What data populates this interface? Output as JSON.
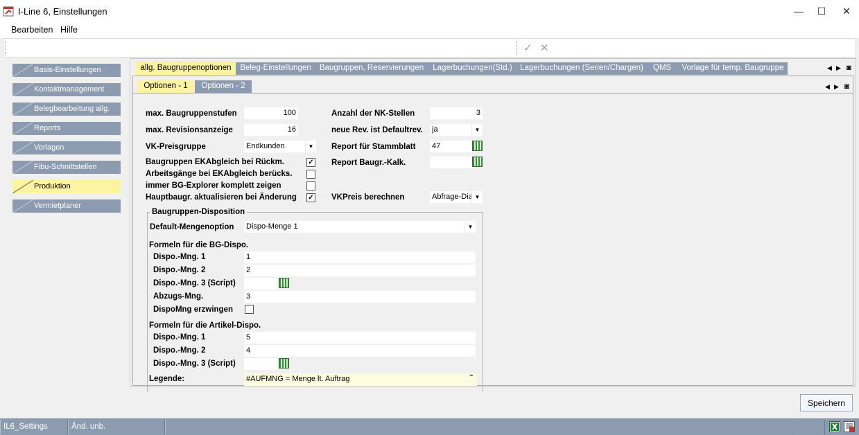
{
  "window": {
    "title": "I-Line 6, Einstellungen",
    "controls": {
      "minimize": "—",
      "maximize": "☐",
      "close": "✕"
    }
  },
  "menu": [
    "Bearbeiten",
    "Hilfe"
  ],
  "toolbar": {
    "confirm": "✓",
    "cancel": "✕"
  },
  "sidebar": {
    "items": [
      {
        "label": "Basis-Einstellungen"
      },
      {
        "label": "Kontaktmanagement"
      },
      {
        "label": "Belegbearbeitung allg."
      },
      {
        "label": "Reports"
      },
      {
        "label": "Vorlagen"
      },
      {
        "label": "Fibu-Schnittstellen"
      },
      {
        "label": "Produktion",
        "active": true
      },
      {
        "label": "Vermietplaner"
      }
    ]
  },
  "tabs": [
    {
      "label": "allg. Baugruppenoptionen",
      "active": true
    },
    {
      "label": "Beleg-Einstellungen"
    },
    {
      "label": "Baugruppen, Reservierungen"
    },
    {
      "label": "Lagerbuchungen(Std.)"
    },
    {
      "label": "Lagerbuchungen (Serien/Chargen)"
    },
    {
      "label": "QMS"
    },
    {
      "label": "Vorlage für temp. Baugruppe"
    }
  ],
  "subtabs": [
    {
      "label": "Optionen - 1",
      "active": true
    },
    {
      "label": "Optionen - 2"
    }
  ],
  "form": {
    "max_stufen": {
      "label": "max. Baugruppenstufen",
      "value": "100"
    },
    "max_rev": {
      "label": "max. Revisionsanzeige",
      "value": "16"
    },
    "vk_preisgruppe": {
      "label": "VK-Preisgruppe",
      "value": "Endkunden"
    },
    "ek_rueckm": {
      "label": "Baugruppen EKAbgleich bei Rückm.",
      "checked": true
    },
    "ag_ek": {
      "label": "Arbeitsgänge bei EKAbgleich berücks.",
      "checked": false
    },
    "bg_explorer": {
      "label": "immer BG-Explorer komplett zeigen",
      "checked": false
    },
    "hauptbaugr": {
      "label": "Hauptbaugr. aktualisieren bei Änderung",
      "checked": true
    },
    "nk_stellen": {
      "label": "Anzahl der NK-Stellen",
      "value": "3"
    },
    "neue_rev": {
      "label": "neue Rev. ist Defaultrev.",
      "value": "ja"
    },
    "report_stammblatt": {
      "label": "Report für Stammblatt",
      "value": "47"
    },
    "report_kalk": {
      "label": "Report Baugr.-Kalk.",
      "value": ""
    },
    "vkpreis": {
      "label": "VKPreis berechnen",
      "value": "Abfrage-Dia"
    }
  },
  "disposition": {
    "group_title": "Baugruppen-Disposition",
    "default_menge": {
      "label": "Default-Mengenoption",
      "value": "Dispo-Menge 1"
    },
    "bg_heading": "Formeln für die BG-Dispo.",
    "bg": [
      {
        "label": "Dispo.-Mng. 1",
        "value": "1"
      },
      {
        "label": "Dispo.-Mng. 2",
        "value": "2"
      },
      {
        "label": "Dispo.-Mng. 3 (Script)",
        "value": ""
      },
      {
        "label": "Abzugs-Mng.",
        "value": "3"
      }
    ],
    "erzwingen": {
      "label": "DispoMng erzwingen",
      "checked": false
    },
    "art_heading": "Formeln für die Artikel-Dispo.",
    "art": [
      {
        "label": "Dispo.-Mng. 1",
        "value": "5"
      },
      {
        "label": "Dispo.-Mng. 2",
        "value": "4"
      },
      {
        "label": "Dispo.-Mng. 3 (Script)",
        "value": ""
      }
    ],
    "legende": {
      "label": "Legende:",
      "value": "#AUFMNG = Menge lt. Auftrag"
    }
  },
  "save_label": "Speichern",
  "status": {
    "app": "IL6_Settings",
    "state": "Änd. unb."
  },
  "colors": {
    "tab_inactive": "#8d9bb0",
    "tab_active": "#fdf3a0"
  }
}
